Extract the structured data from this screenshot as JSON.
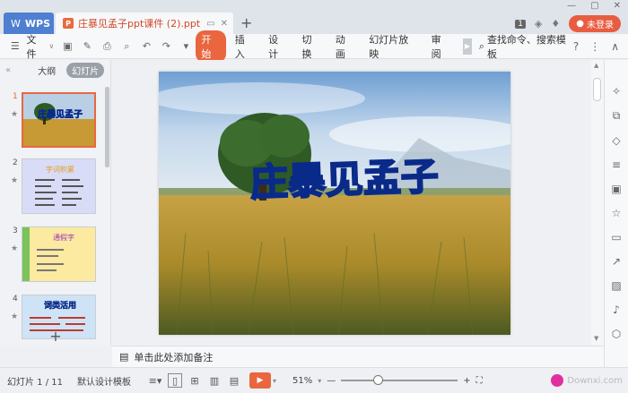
{
  "titlebar": {
    "wps_label": "WPS",
    "doc_tab_title": "庄暴见孟子ppt课件 (2).ppt",
    "badge": "1",
    "login_label": "未登录"
  },
  "menubar": {
    "file_label": "文件",
    "tabs": [
      "开始",
      "插入",
      "设计",
      "切换",
      "动画",
      "幻灯片放映",
      "审阅"
    ],
    "active_tab": "开始",
    "search_label": "查找命令、搜索模板"
  },
  "leftpanel": {
    "tab_outline": "大纲",
    "tab_slides": "幻灯片",
    "thumbnails": [
      {
        "num": "1",
        "title": "庄暴见孟子"
      },
      {
        "num": "2",
        "title": "字词积累"
      },
      {
        "num": "3",
        "title": "通假字"
      },
      {
        "num": "4",
        "title": "词类活用"
      }
    ]
  },
  "slide": {
    "title": "庄暴见孟子",
    "colors": {
      "title_fill": "#1e8fe6",
      "title_stroke": "#0a2a8a",
      "sky": "#a9c5e3",
      "grass": "#b58e2a"
    }
  },
  "notes": {
    "placeholder": "单击此处添加备注"
  },
  "statusbar": {
    "slide_info": "幻灯片 1 / 11",
    "template": "默认设计模板",
    "zoom": "51%",
    "zoom_fraction": 0.31,
    "watermark": "Downxi.com"
  }
}
